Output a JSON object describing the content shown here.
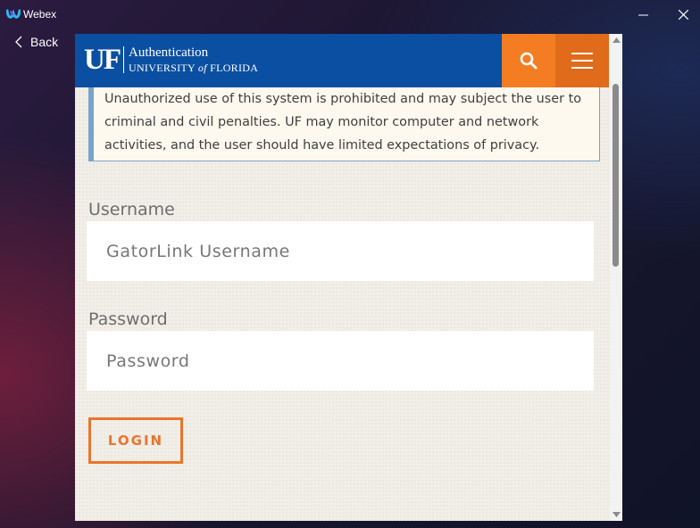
{
  "window": {
    "title": "Webex",
    "back_label": "Back"
  },
  "header": {
    "logo_text": "UF",
    "auth_title": "Authentication",
    "university_prefix": "UNIVERSITY ",
    "university_of": "of",
    "university_suffix": " FLORIDA",
    "search_icon": "search-icon",
    "menu_icon": "hamburger-menu-icon"
  },
  "notice": {
    "text": "Unauthorized use of this system is prohibited and may subject the user to criminal and civil penalties. UF may monitor computer and network activities, and the user should have limited expectations of privacy."
  },
  "form": {
    "username_label": "Username",
    "username_placeholder": "GatorLink Username",
    "password_label": "Password",
    "password_placeholder": "Password",
    "login_label": "LOGIN"
  },
  "colors": {
    "uf_blue": "#0a4fa1",
    "uf_orange": "#f47d23",
    "login_orange": "#e8762d"
  }
}
